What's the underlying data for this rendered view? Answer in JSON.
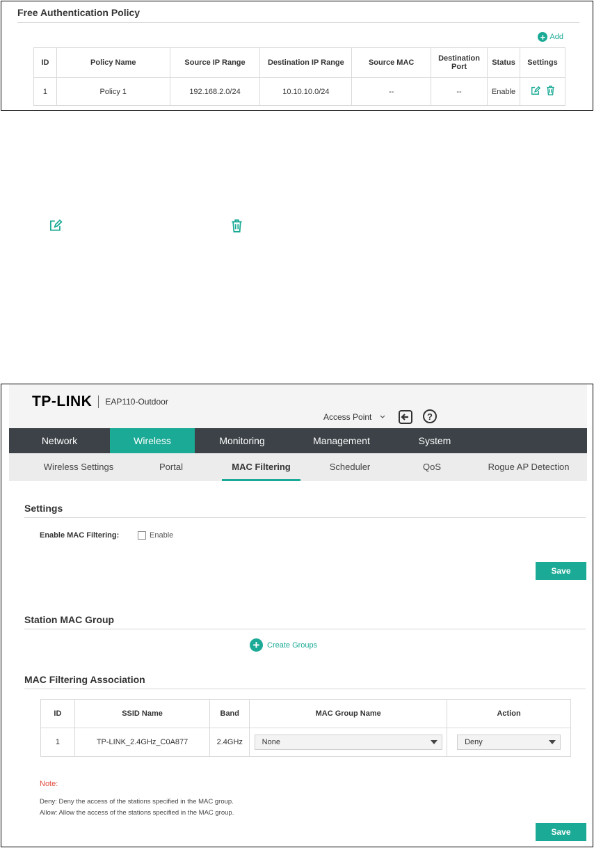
{
  "top": {
    "title": "Free Authentication Policy",
    "add_label": "Add",
    "table": {
      "headers": [
        "ID",
        "Policy Name",
        "Source IP Range",
        "Destination IP Range",
        "Source MAC",
        "Destination Port",
        "Status",
        "Settings"
      ],
      "rows": [
        {
          "id": "1",
          "name": "Policy 1",
          "src_ip": "192.168.2.0/24",
          "dst_ip": "10.10.10.0/24",
          "src_mac": "--",
          "dst_port": "--",
          "status": "Enable"
        }
      ]
    }
  },
  "app": {
    "brand": "TP-LINK",
    "model": "EAP110-Outdoor",
    "mode": "Access Point",
    "help_glyph": "?",
    "main_nav": [
      "Network",
      "Wireless",
      "Monitoring",
      "Management",
      "System"
    ],
    "sub_nav": [
      "Wireless Settings",
      "Portal",
      "MAC Filtering",
      "Scheduler",
      "QoS",
      "Rogue AP Detection"
    ]
  },
  "settings": {
    "title": "Settings",
    "enable_label": "Enable MAC Filtering:",
    "enable_text": "Enable",
    "enabled": false,
    "save": "Save"
  },
  "station_group": {
    "title": "Station MAC Group",
    "create_label": "Create Groups"
  },
  "association": {
    "title": "MAC Filtering Association",
    "headers": [
      "ID",
      "SSID Name",
      "Band",
      "MAC Group Name",
      "Action"
    ],
    "rows": [
      {
        "id": "1",
        "ssid": "TP-LINK_2.4GHz_C0A877",
        "band": "2.4GHz",
        "group": "None",
        "action": "Deny"
      }
    ]
  },
  "note": {
    "title": "Note:",
    "lines": [
      "Deny: Deny the access of the stations specified in the MAC group.",
      "Allow: Allow the access of the stations specified in the MAC group."
    ],
    "save": "Save"
  },
  "colors": {
    "accent": "#1aaa95",
    "nav_dark": "#3c4247",
    "note_red": "#e04d3b"
  },
  "icons": [
    "add-icon",
    "edit-icon",
    "delete-icon",
    "logout-icon",
    "help-icon",
    "chevron-down-icon"
  ]
}
